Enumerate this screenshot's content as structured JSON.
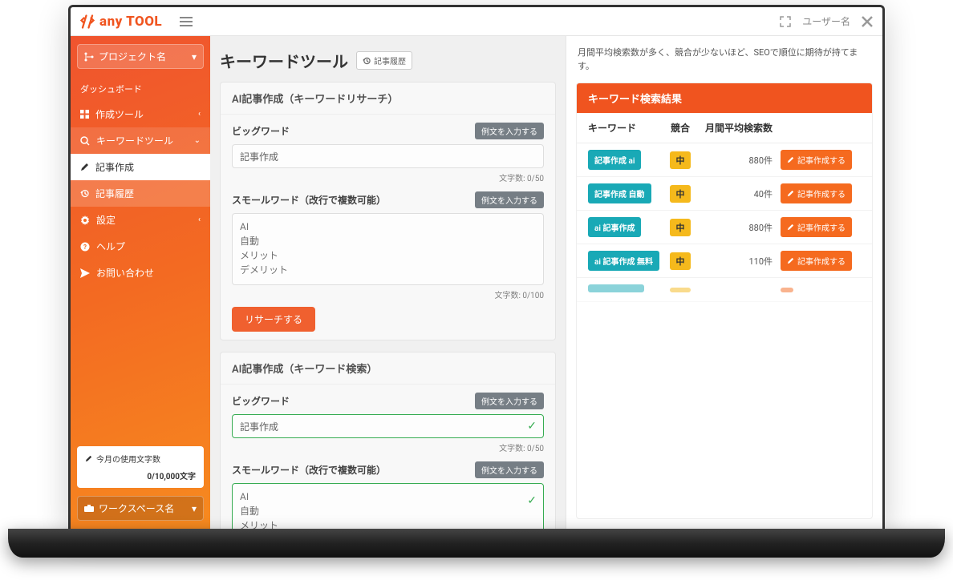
{
  "brand": "any TOOL",
  "topbar": {
    "username": "ユーザー名"
  },
  "sidebar": {
    "project_label": "プロジェクト名",
    "dashboard": "ダッシュボード",
    "create_tool": "作成ツール",
    "keyword_tool": "キーワードツール",
    "article_create": "記事作成",
    "article_history": "記事履歴",
    "settings": "設定",
    "help": "ヘルプ",
    "contact": "お問い合わせ",
    "usage_label": "今月の使用文字数",
    "usage_value": "0/10,000文字",
    "workspace_label": "ワークスペース名"
  },
  "page": {
    "title": "キーワードツール",
    "history_btn": "記事履歴"
  },
  "card1": {
    "title": "AI記事作成（キーワードリサーチ）",
    "bigword_label": "ビッグワード",
    "example_btn": "例文を入力する",
    "bigword_value": "記事作成",
    "bigword_count": "文字数: 0/50",
    "smallword_label": "スモールワード（改行で複数可能）",
    "smallword_value": "AI\n自動\nメリット\nデメリット",
    "smallword_count": "文字数: 0/100",
    "research_btn": "リサーチする"
  },
  "card2": {
    "title": "AI記事作成（キーワード検索）",
    "bigword_label": "ビッグワード",
    "example_btn": "例文を入力する",
    "bigword_value": "記事作成",
    "bigword_count": "文字数: 0/50",
    "smallword_label": "スモールワード（改行で複数可能）",
    "smallword_value": "AI\n自動\nメリット\nデメリット"
  },
  "right": {
    "info": "月間平均検索数が多く、競合が少ないほど、SEOで順位に期待が持てます。",
    "result_title": "キーワード検索結果",
    "cols": {
      "keyword": "キーワード",
      "competition": "競合",
      "volume": "月間平均検索数"
    },
    "make_btn": "記事作成する",
    "rows": [
      {
        "keyword": "記事作成 ai",
        "competition": "中",
        "volume": "880件"
      },
      {
        "keyword": "記事作成 自動",
        "competition": "中",
        "volume": "40件"
      },
      {
        "keyword": "ai 記事作成",
        "competition": "中",
        "volume": "880件"
      },
      {
        "keyword": "ai 記事作成 無料",
        "competition": "中",
        "volume": "110件"
      }
    ]
  }
}
